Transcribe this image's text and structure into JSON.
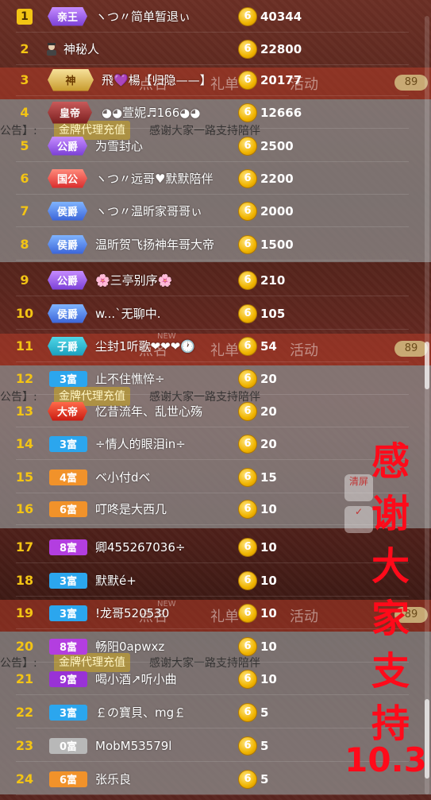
{
  "background": {
    "tabs": [
      "礼单",
      "活动",
      "点名"
    ],
    "gift_tab": "礼单",
    "activity_tab": "活动",
    "notice_prefix": "公告】:",
    "notice_badge": "金牌代理充值",
    "notice_text": "感谢大家一路支持陪伴",
    "level_badge": "89",
    "clear_label": "清屏",
    "new_tag": "NEW"
  },
  "ranking": [
    {
      "rank": "1",
      "badge": "亲王",
      "badge_style": "b-purple",
      "name": "ヽつ〃简单暂退ぃ",
      "score": "40344"
    },
    {
      "rank": "2",
      "badge": "",
      "badge_style": "avatar",
      "name": "神秘人",
      "score": "22800"
    },
    {
      "rank": "3",
      "badge": "神",
      "badge_style": "b-god",
      "name": "飛💜楊【归隐——】",
      "score": "20177"
    },
    {
      "rank": "4",
      "badge": "皇帝",
      "badge_style": "b-king",
      "name": "◕◕萱妮♬166◕◕",
      "score": "12666"
    },
    {
      "rank": "5",
      "badge": "公爵",
      "badge_style": "b-purple",
      "name": "为雪封心",
      "score": "2500"
    },
    {
      "rank": "6",
      "badge": "国公",
      "badge_style": "b-red",
      "name": "ヽつ〃远哥♥默默陪伴",
      "score": "2200"
    },
    {
      "rank": "7",
      "badge": "侯爵",
      "badge_style": "b-blue",
      "name": "ヽつ〃温昕家哥哥ぃ",
      "score": "2000"
    },
    {
      "rank": "8",
      "badge": "侯爵",
      "badge_style": "b-blue",
      "name": "温昕贺飞扬神年哥大帝",
      "score": "1500"
    },
    {
      "rank": "9",
      "badge": "公爵",
      "badge_style": "b-purple",
      "name": "🌸三亭别序🌸",
      "score": "210"
    },
    {
      "rank": "10",
      "badge": "侯爵",
      "badge_style": "b-blue",
      "name": "w...`无聊中.",
      "score": "105"
    },
    {
      "rank": "11",
      "badge": "子爵",
      "badge_style": "b-teal",
      "name": "尘封1听歌❤❤❤🕐",
      "score": "54"
    },
    {
      "rank": "12",
      "badge": "3富",
      "badge_style": "w3",
      "name": "止不住憔悴÷",
      "score": "20"
    },
    {
      "rank": "13",
      "badge": "大帝",
      "badge_style": "b-dadi",
      "name": "忆昔流年、乱世心殇",
      "score": "20"
    },
    {
      "rank": "14",
      "badge": "3富",
      "badge_style": "w3",
      "name": "÷情人的眼泪in÷",
      "score": "20"
    },
    {
      "rank": "15",
      "badge": "4富",
      "badge_style": "w4",
      "name": "ベ小付dベ",
      "score": "15"
    },
    {
      "rank": "16",
      "badge": "6富",
      "badge_style": "w6",
      "name": "叮咚是大西几",
      "score": "10"
    },
    {
      "rank": "17",
      "badge": "8富",
      "badge_style": "w8",
      "name": "卿455267036÷",
      "score": "10"
    },
    {
      "rank": "18",
      "badge": "3富",
      "badge_style": "w3",
      "name": "默默é+",
      "score": "10"
    },
    {
      "rank": "19",
      "badge": "3富",
      "badge_style": "w3",
      "name": "!龙哥520530",
      "score": "10"
    },
    {
      "rank": "20",
      "badge": "8富",
      "badge_style": "w8",
      "name": "畅阳0apwxz",
      "score": "10"
    },
    {
      "rank": "21",
      "badge": "9富",
      "badge_style": "w9",
      "name": "喝小酒↗听小曲",
      "score": "10"
    },
    {
      "rank": "22",
      "badge": "3富",
      "badge_style": "w3",
      "name": "￡の寶貝、mg￡",
      "score": "5"
    },
    {
      "rank": "23",
      "badge": "0富",
      "badge_style": "w0",
      "name": "MobM53579l",
      "score": "5"
    },
    {
      "rank": "24",
      "badge": "6富",
      "badge_style": "w6",
      "name": "张乐良",
      "score": "5"
    }
  ],
  "coin_glyph": "6",
  "overlay": {
    "chars": [
      "感",
      "谢",
      "大",
      "家",
      "支",
      "持"
    ],
    "version": "10.3",
    "color": "#ff0a1a"
  }
}
